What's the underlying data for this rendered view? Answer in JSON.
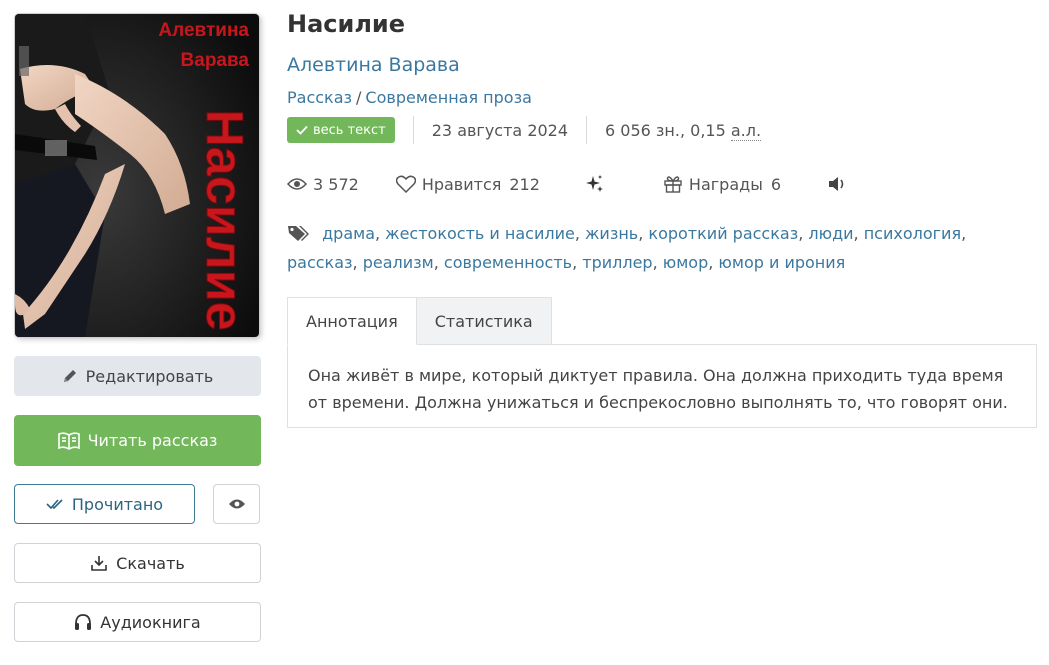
{
  "book": {
    "title": "Насилие",
    "author": "Алевтина Варава",
    "genre_type": "Рассказ",
    "genre_separator": "/",
    "genre": "Современная проза",
    "status_badge": "весь текст",
    "date": "23 августа 2024",
    "size": "6 056 зн., 0,15 ",
    "size_unit": "а.л."
  },
  "cover": {
    "author_line1": "Алевтина",
    "author_line2": "Варава",
    "title": "Насилие"
  },
  "stats": {
    "views": "3 572",
    "likes_label": "Нравится",
    "likes_count": "212",
    "awards_label": "Награды",
    "awards_count": "6"
  },
  "tags": [
    "драма",
    "жестокость и насилие",
    "жизнь",
    "короткий рассказ",
    "люди",
    "психология",
    "рассказ",
    "реализм",
    "современность",
    "триллер",
    "юмор",
    "юмор и ирония"
  ],
  "buttons": {
    "edit": "Редактировать",
    "read": "Читать рассказ",
    "done": "Прочитано",
    "download": "Скачать",
    "audiobook": "Аудиокнига"
  },
  "tabs": {
    "annotation": "Аннотация",
    "statistics": "Статистика"
  },
  "annotation_text": "Она живёт в мире, который диктует правила. Она должна приходить туда время от времени. Должна унижаться и беспрекословно выполнять то, что говорят они.",
  "colors": {
    "accent_green": "#72b85a",
    "link_blue": "#3a78a0",
    "cover_title_red": "#c8161d"
  },
  "icons": {
    "edit": "pencil-icon",
    "read": "open-book-icon",
    "done": "double-check-icon",
    "hide": "eye-icon",
    "download": "download-icon",
    "audiobook": "headphones-icon",
    "views": "eye-icon",
    "likes": "heart-icon",
    "sparkle": "sparkles-icon",
    "awards": "gift-icon",
    "listen": "speaker-icon",
    "tags": "tags-icon",
    "badge": "check-icon"
  }
}
